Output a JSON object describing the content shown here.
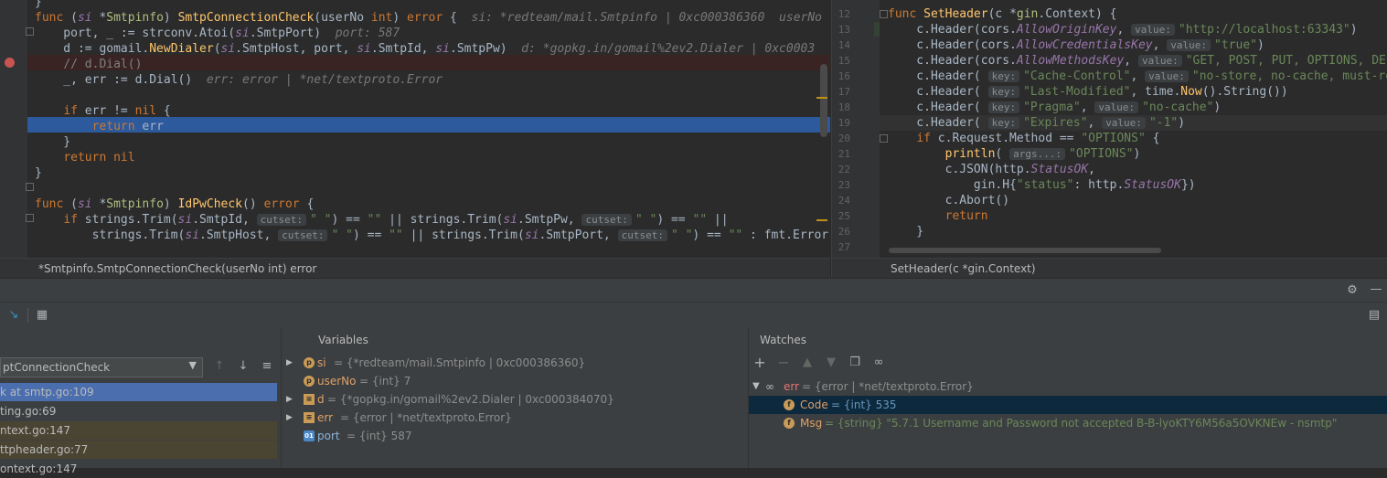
{
  "left_editor": {
    "lines": [
      {
        "html": "}"
      },
      {
        "html": "<span class='kw'>func</span> (<span class='it'>si</span> *<span class='pkg'>Smtpinfo</span>) <span class='fn'>SmtpConnectionCheck</span>(userNo <span class='kw'>int</span>) <span class='kw'>error</span> {  <span class='hint'>si: *redteam/mail.Smtpinfo | 0xc000386360  userNo</span>"
      },
      {
        "html": "    port, _ := strconv.Atoi(<span class='it'>si</span>.SmtpPort)  <span class='hint'>port: 587</span>"
      },
      {
        "html": "    d := gomail.<span class='fn'>NewDialer</span>(<span class='it'>si</span>.SmtpHost, port, <span class='it'>si</span>.SmtpId, <span class='it'>si</span>.SmtpPw)  <span class='hint'>d: *gopkg.in/gomail%2ev2.Dialer | 0xc0003</span>"
      },
      {
        "html": "    <span class='cm'>// d.Dial()</span>"
      },
      {
        "html": "    _, err := d.Dial()  <span class='hint'>err: error | *net/textproto.Error</span>"
      },
      {
        "html": ""
      },
      {
        "html": "    <span class='kw'>if</span> err != <span class='kw'>nil</span> {"
      },
      {
        "html": "        <span class='kw'>return</span> err"
      },
      {
        "html": "    }"
      },
      {
        "html": "    <span class='kw'>return</span> <span class='kw'>nil</span>"
      },
      {
        "html": "}"
      },
      {
        "html": ""
      },
      {
        "html": "<span class='kw'>func</span> (<span class='it'>si</span> *<span class='pkg'>Smtpinfo</span>) <span class='fn'>IdPwCheck</span>() <span class='kw'>error</span> {"
      },
      {
        "html": "    <span class='kw'>if</span> strings.Trim(<span class='it'>si</span>.SmtpId, <span class='ph'>cutset:</span><span class='str'>\" \"</span>) == <span class='str'>\"\"</span> || strings.Trim(<span class='it'>si</span>.SmtpPw, <span class='ph'>cutset:</span><span class='str'>\" \"</span>) == <span class='str'>\"\"</span> ||"
      },
      {
        "html": "        strings.Trim(<span class='it'>si</span>.SmtpHost, <span class='ph'>cutset:</span><span class='str'>\" \"</span>) == <span class='str'>\"\"</span> || strings.Trim(<span class='it'>si</span>.SmtpPort, <span class='ph'>cutset:</span><span class='str'>\" \"</span>) == <span class='str'>\"\"</span> : fmt.Error"
      }
    ],
    "breadcrumb": "*Smtpinfo.SmtpConnectionCheck(userNo int) error"
  },
  "right_editor": {
    "line_numbers": [
      "12",
      "13",
      "14",
      "15",
      "16",
      "17",
      "18",
      "19",
      "20",
      "21",
      "22",
      "23",
      "24",
      "25",
      "26",
      "27"
    ],
    "lines": [
      {
        "html": "<span class='kw'>func</span> <span class='fn'>SetHeader</span>(c *<span class='pkg'>gin</span>.Context) {"
      },
      {
        "html": "    c.Header(cors.<span class='it'>AllowOriginKey</span>, <span class='ph'>value:</span><span class='str'>\"http://localhost:63343\"</span>)"
      },
      {
        "html": "    c.Header(cors.<span class='it'>AllowCredentialsKey</span>, <span class='ph'>value:</span><span class='str'>\"true\"</span>)"
      },
      {
        "html": "    c.Header(cors.<span class='it'>AllowMethodsKey</span>, <span class='ph'>value:</span><span class='str'>\"GET, POST, PUT, OPTIONS, DE</span>"
      },
      {
        "html": "    c.Header( <span class='ph'>key:</span><span class='str'>\"Cache-Control\"</span>, <span class='ph'>value:</span><span class='str'>\"no-store, no-cache, must-re</span>"
      },
      {
        "html": "    c.Header( <span class='ph'>key:</span><span class='str'>\"Last-Modified\"</span>, time.<span class='fn'>Now</span>().String())"
      },
      {
        "html": "    c.Header( <span class='ph'>key:</span><span class='str'>\"Pragma\"</span>, <span class='ph'>value:</span><span class='str'>\"no-cache\"</span>)"
      },
      {
        "html": "    c.Header( <span class='ph'>key:</span><span class='str'>\"Expires\"</span>, <span class='ph'>value:</span><span class='str'>\"-1\"</span>)"
      },
      {
        "html": "    <span class='kw'>if</span> c.Request.Method == <span class='str'>\"OPTIONS\"</span> {"
      },
      {
        "html": "        <span class='fn'>println</span>( <span class='ph'>args...:</span><span class='str'>\"OPTIONS\"</span>)"
      },
      {
        "html": "        c.JSON(http.<span class='it'>StatusOK</span>,"
      },
      {
        "html": "            gin.H{<span class='str'>\"status\"</span>: http.<span class='it'>StatusOK</span>})"
      },
      {
        "html": "        c.Abort()"
      },
      {
        "html": "        <span class='kw'>return</span>"
      },
      {
        "html": "    }"
      },
      {
        "html": ""
      }
    ],
    "breadcrumb": "SetHeader(c *gin.Context)"
  },
  "frames": {
    "thread": "ptConnectionCheck",
    "items": [
      "k at smtp.go:109",
      "ting.go:69",
      "ntext.go:147",
      "ttpheader.go:77",
      "ontext.go:147"
    ]
  },
  "variables": {
    "title": "Variables",
    "items": [
      {
        "name": "si",
        "value": "= {*redteam/mail.Smtpinfo | 0xc000386360}",
        "icon": "p",
        "expandable": true
      },
      {
        "name": "userNo",
        "value": "= {int} 7",
        "icon": "p",
        "expandable": false
      },
      {
        "name": "d",
        "value": "= {*gopkg.in/gomail%2ev2.Dialer | 0xc000384070}",
        "icon": "list",
        "expandable": true
      },
      {
        "name": "err",
        "value": "= {error | *net/textproto.Error}",
        "icon": "list",
        "expandable": true
      },
      {
        "name": "port",
        "value": "= {int} 587",
        "icon": "01",
        "expandable": false
      }
    ]
  },
  "watches": {
    "title": "Watches",
    "root": {
      "name": "err",
      "value": "= {error | *net/textproto.Error}"
    },
    "children": [
      {
        "name": "Code",
        "value": "= {int} 535"
      },
      {
        "name": "Msg",
        "value": "= {string} \"5.7.1 Username and Password not accepted B-B-lyoKTY6M56a5OVKNEw - nsmtp\""
      }
    ]
  },
  "colors": {
    "exec_line": "#2d5a9c",
    "breakpoint": "#c75450",
    "selected_frame": "#4b6eaf",
    "selected_watch": "#0d293e"
  }
}
